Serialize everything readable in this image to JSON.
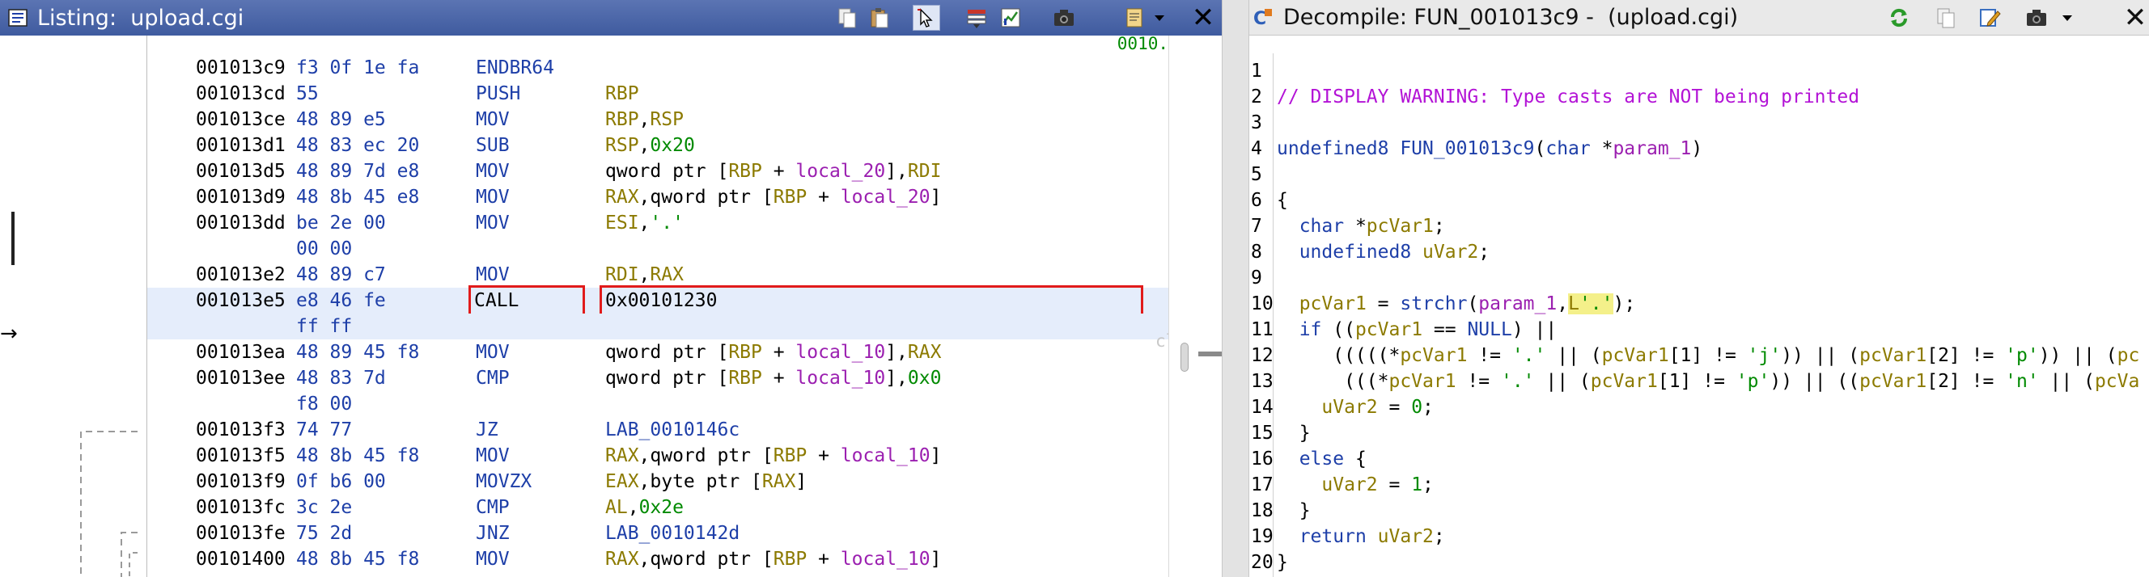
{
  "listing": {
    "title": "Listing:  upload.cgi",
    "top_right_label": "0010.",
    "clipped_label": "cl",
    "rows": [
      {
        "addr": "001013c9",
        "bytes": "f3 0f 1e fa",
        "mnemonic": "ENDBR64",
        "operands": []
      },
      {
        "addr": "001013cd",
        "bytes": "55",
        "mnemonic": "PUSH",
        "operands": [
          {
            "t": "RBP",
            "c": "reg"
          }
        ]
      },
      {
        "addr": "001013ce",
        "bytes": "48 89 e5",
        "mnemonic": "MOV",
        "operands": [
          {
            "t": "RBP",
            "c": "reg"
          },
          {
            "t": ",",
            "c": "plain"
          },
          {
            "t": "RSP",
            "c": "reg"
          }
        ]
      },
      {
        "addr": "001013d1",
        "bytes": "48 83 ec 20",
        "mnemonic": "SUB",
        "operands": [
          {
            "t": "RSP",
            "c": "reg"
          },
          {
            "t": ",",
            "c": "plain"
          },
          {
            "t": "0x20",
            "c": "num"
          }
        ]
      },
      {
        "addr": "001013d5",
        "bytes": "48 89 7d e8",
        "mnemonic": "MOV",
        "operands": [
          {
            "t": "qword ptr [",
            "c": "plain"
          },
          {
            "t": "RBP",
            "c": "reg"
          },
          {
            "t": " + ",
            "c": "plain"
          },
          {
            "t": "local_20",
            "c": "loc"
          },
          {
            "t": "],",
            "c": "plain"
          },
          {
            "t": "RDI",
            "c": "reg"
          }
        ]
      },
      {
        "addr": "001013d9",
        "bytes": "48 8b 45 e8",
        "mnemonic": "MOV",
        "operands": [
          {
            "t": "RAX",
            "c": "reg"
          },
          {
            "t": ",qword ptr [",
            "c": "plain"
          },
          {
            "t": "RBP",
            "c": "reg"
          },
          {
            "t": " + ",
            "c": "plain"
          },
          {
            "t": "local_20",
            "c": "loc"
          },
          {
            "t": "]",
            "c": "plain"
          }
        ]
      },
      {
        "addr": "001013dd",
        "bytes": "be 2e 00",
        "mnemonic": "MOV",
        "operands": [
          {
            "t": "ESI",
            "c": "reg"
          },
          {
            "t": ",",
            "c": "plain"
          },
          {
            "t": "'.'",
            "c": "str"
          }
        ]
      },
      {
        "addr": "",
        "bytes": "00 00",
        "mnemonic": "",
        "operands": []
      },
      {
        "addr": "001013e2",
        "bytes": "48 89 c7",
        "mnemonic": "MOV",
        "operands": [
          {
            "t": "RDI",
            "c": "reg"
          },
          {
            "t": ",",
            "c": "plain"
          },
          {
            "t": "RAX",
            "c": "reg"
          }
        ]
      },
      {
        "addr": "001013e5",
        "bytes": "e8 46 fe",
        "mnemonic": "CALL",
        "operands": [
          {
            "t": "0x00101230",
            "c": "plain"
          }
        ],
        "selected": true
      },
      {
        "addr": "",
        "bytes": "ff ff",
        "mnemonic": "",
        "operands": [],
        "selected": true
      },
      {
        "addr": "001013ea",
        "bytes": "48 89 45 f8",
        "mnemonic": "MOV",
        "operands": [
          {
            "t": "qword ptr [",
            "c": "plain"
          },
          {
            "t": "RBP",
            "c": "reg"
          },
          {
            "t": " + ",
            "c": "plain"
          },
          {
            "t": "local_10",
            "c": "loc"
          },
          {
            "t": "],",
            "c": "plain"
          },
          {
            "t": "RAX",
            "c": "reg"
          }
        ]
      },
      {
        "addr": "001013ee",
        "bytes": "48 83 7d",
        "mnemonic": "CMP",
        "operands": [
          {
            "t": "qword ptr [",
            "c": "plain"
          },
          {
            "t": "RBP",
            "c": "reg"
          },
          {
            "t": " + ",
            "c": "plain"
          },
          {
            "t": "local_10",
            "c": "loc"
          },
          {
            "t": "],",
            "c": "plain"
          },
          {
            "t": "0x0",
            "c": "num"
          }
        ]
      },
      {
        "addr": "",
        "bytes": "f8 00",
        "mnemonic": "",
        "operands": []
      },
      {
        "addr": "001013f3",
        "bytes": "74 77",
        "mnemonic": "JZ",
        "operands": [
          {
            "t": "LAB_0010146c",
            "c": "fn"
          }
        ]
      },
      {
        "addr": "001013f5",
        "bytes": "48 8b 45 f8",
        "mnemonic": "MOV",
        "operands": [
          {
            "t": "RAX",
            "c": "reg"
          },
          {
            "t": ",qword ptr [",
            "c": "plain"
          },
          {
            "t": "RBP",
            "c": "reg"
          },
          {
            "t": " + ",
            "c": "plain"
          },
          {
            "t": "local_10",
            "c": "loc"
          },
          {
            "t": "]",
            "c": "plain"
          }
        ]
      },
      {
        "addr": "001013f9",
        "bytes": "0f b6 00",
        "mnemonic": "MOVZX",
        "operands": [
          {
            "t": "EAX",
            "c": "reg"
          },
          {
            "t": ",byte ptr [",
            "c": "plain"
          },
          {
            "t": "RAX",
            "c": "reg"
          },
          {
            "t": "]",
            "c": "plain"
          }
        ]
      },
      {
        "addr": "001013fc",
        "bytes": "3c 2e",
        "mnemonic": "CMP",
        "operands": [
          {
            "t": "AL",
            "c": "reg"
          },
          {
            "t": ",",
            "c": "plain"
          },
          {
            "t": "0x2e",
            "c": "num"
          }
        ]
      },
      {
        "addr": "001013fe",
        "bytes": "75 2d",
        "mnemonic": "JNZ",
        "operands": [
          {
            "t": "LAB_0010142d",
            "c": "fn"
          }
        ]
      },
      {
        "addr": "00101400",
        "bytes": "48 8b 45 f8",
        "mnemonic": "MOV",
        "operands": [
          {
            "t": "RAX",
            "c": "reg"
          },
          {
            "t": ",qword ptr [",
            "c": "plain"
          },
          {
            "t": "RBP",
            "c": "reg"
          },
          {
            "t": " + ",
            "c": "plain"
          },
          {
            "t": "local_10",
            "c": "loc"
          },
          {
            "t": "]",
            "c": "plain"
          }
        ]
      }
    ]
  },
  "decompile": {
    "title": "Decompile: FUN_001013c9 -  (upload.cgi)",
    "lines": [
      [],
      [
        {
          "t": "// DISPLAY WARNING: Type casts are NOT being printed",
          "c": "cm"
        }
      ],
      [],
      [
        {
          "t": "undefined8 ",
          "c": "k"
        },
        {
          "t": "FUN_001013c9",
          "c": "fn"
        },
        {
          "t": "(",
          "c": ""
        },
        {
          "t": "char",
          "c": "k"
        },
        {
          "t": " *",
          "c": ""
        },
        {
          "t": "param_1",
          "c": "p"
        },
        {
          "t": ")",
          "c": ""
        }
      ],
      [],
      [
        {
          "t": "{",
          "c": ""
        }
      ],
      [
        {
          "t": "  ",
          "c": ""
        },
        {
          "t": "char",
          "c": "k"
        },
        {
          "t": " *",
          "c": ""
        },
        {
          "t": "pcVar1",
          "c": "v"
        },
        {
          "t": ";",
          "c": ""
        }
      ],
      [
        {
          "t": "  ",
          "c": ""
        },
        {
          "t": "undefined8",
          "c": "k"
        },
        {
          "t": " ",
          "c": ""
        },
        {
          "t": "uVar2",
          "c": "v"
        },
        {
          "t": ";",
          "c": ""
        }
      ],
      [],
      [
        {
          "t": "  ",
          "c": ""
        },
        {
          "t": "pcVar1",
          "c": "v"
        },
        {
          "t": " = ",
          "c": ""
        },
        {
          "t": "strchr",
          "c": "fn"
        },
        {
          "t": "(",
          "c": ""
        },
        {
          "t": "param_1",
          "c": "p"
        },
        {
          "t": ",",
          "c": ""
        },
        {
          "t": "L",
          "c": "v hlyellow"
        },
        {
          "t": "'.'",
          "c": "s hlyellow"
        },
        {
          "t": ");",
          "c": ""
        }
      ],
      [
        {
          "t": "  ",
          "c": ""
        },
        {
          "t": "if",
          "c": "k"
        },
        {
          "t": " ((",
          "c": ""
        },
        {
          "t": "pcVar1",
          "c": "v"
        },
        {
          "t": " == ",
          "c": ""
        },
        {
          "t": "NULL",
          "c": "k"
        },
        {
          "t": ") ||",
          "c": ""
        }
      ],
      [
        {
          "t": "     (((((*",
          "c": ""
        },
        {
          "t": "pcVar1",
          "c": "v"
        },
        {
          "t": " != ",
          "c": ""
        },
        {
          "t": "'.'",
          "c": "s"
        },
        {
          "t": " || (",
          "c": ""
        },
        {
          "t": "pcVar1",
          "c": "v"
        },
        {
          "t": "[1] != ",
          "c": ""
        },
        {
          "t": "'j'",
          "c": "s"
        },
        {
          "t": ")) || (",
          "c": ""
        },
        {
          "t": "pcVar1",
          "c": "v"
        },
        {
          "t": "[2] != ",
          "c": ""
        },
        {
          "t": "'p'",
          "c": "s"
        },
        {
          "t": ")) || (",
          "c": ""
        },
        {
          "t": "pc",
          "c": "v"
        }
      ],
      [
        {
          "t": "      (((*",
          "c": ""
        },
        {
          "t": "pcVar1",
          "c": "v"
        },
        {
          "t": " != ",
          "c": ""
        },
        {
          "t": "'.'",
          "c": "s"
        },
        {
          "t": " || (",
          "c": ""
        },
        {
          "t": "pcVar1",
          "c": "v"
        },
        {
          "t": "[1] != ",
          "c": ""
        },
        {
          "t": "'p'",
          "c": "s"
        },
        {
          "t": ")) || ((",
          "c": ""
        },
        {
          "t": "pcVar1",
          "c": "v"
        },
        {
          "t": "[2] != ",
          "c": ""
        },
        {
          "t": "'n'",
          "c": "s"
        },
        {
          "t": " || (",
          "c": ""
        },
        {
          "t": "pcVa",
          "c": "v"
        }
      ],
      [
        {
          "t": "    ",
          "c": ""
        },
        {
          "t": "uVar2",
          "c": "v"
        },
        {
          "t": " = ",
          "c": ""
        },
        {
          "t": "0",
          "c": "s"
        },
        {
          "t": ";",
          "c": ""
        }
      ],
      [
        {
          "t": "  }",
          "c": ""
        }
      ],
      [
        {
          "t": "  ",
          "c": ""
        },
        {
          "t": "else",
          "c": "k"
        },
        {
          "t": " {",
          "c": ""
        }
      ],
      [
        {
          "t": "    ",
          "c": ""
        },
        {
          "t": "uVar2",
          "c": "v"
        },
        {
          "t": " = ",
          "c": ""
        },
        {
          "t": "1",
          "c": "s"
        },
        {
          "t": ";",
          "c": ""
        }
      ],
      [
        {
          "t": "  }",
          "c": ""
        }
      ],
      [
        {
          "t": "  ",
          "c": ""
        },
        {
          "t": "return",
          "c": "k"
        },
        {
          "t": " ",
          "c": ""
        },
        {
          "t": "uVar2",
          "c": "v"
        },
        {
          "t": ";",
          "c": ""
        }
      ],
      [
        {
          "t": "}",
          "c": ""
        }
      ]
    ]
  },
  "icons": {
    "listing": [
      "listing-window-icon",
      "copy-icon",
      "paste-icon",
      "select-cursor-icon",
      "field-layout-icon",
      "chart-icon",
      "snapshot-camera-icon",
      "edit-format-icon",
      "dropdown-arrow-icon",
      "close-icon"
    ],
    "decompile": [
      "decompile-window-icon",
      "refresh-icon",
      "copy-icon",
      "edit-icon",
      "snapshot-camera-icon",
      "dropdown-arrow-icon",
      "close-icon"
    ]
  }
}
